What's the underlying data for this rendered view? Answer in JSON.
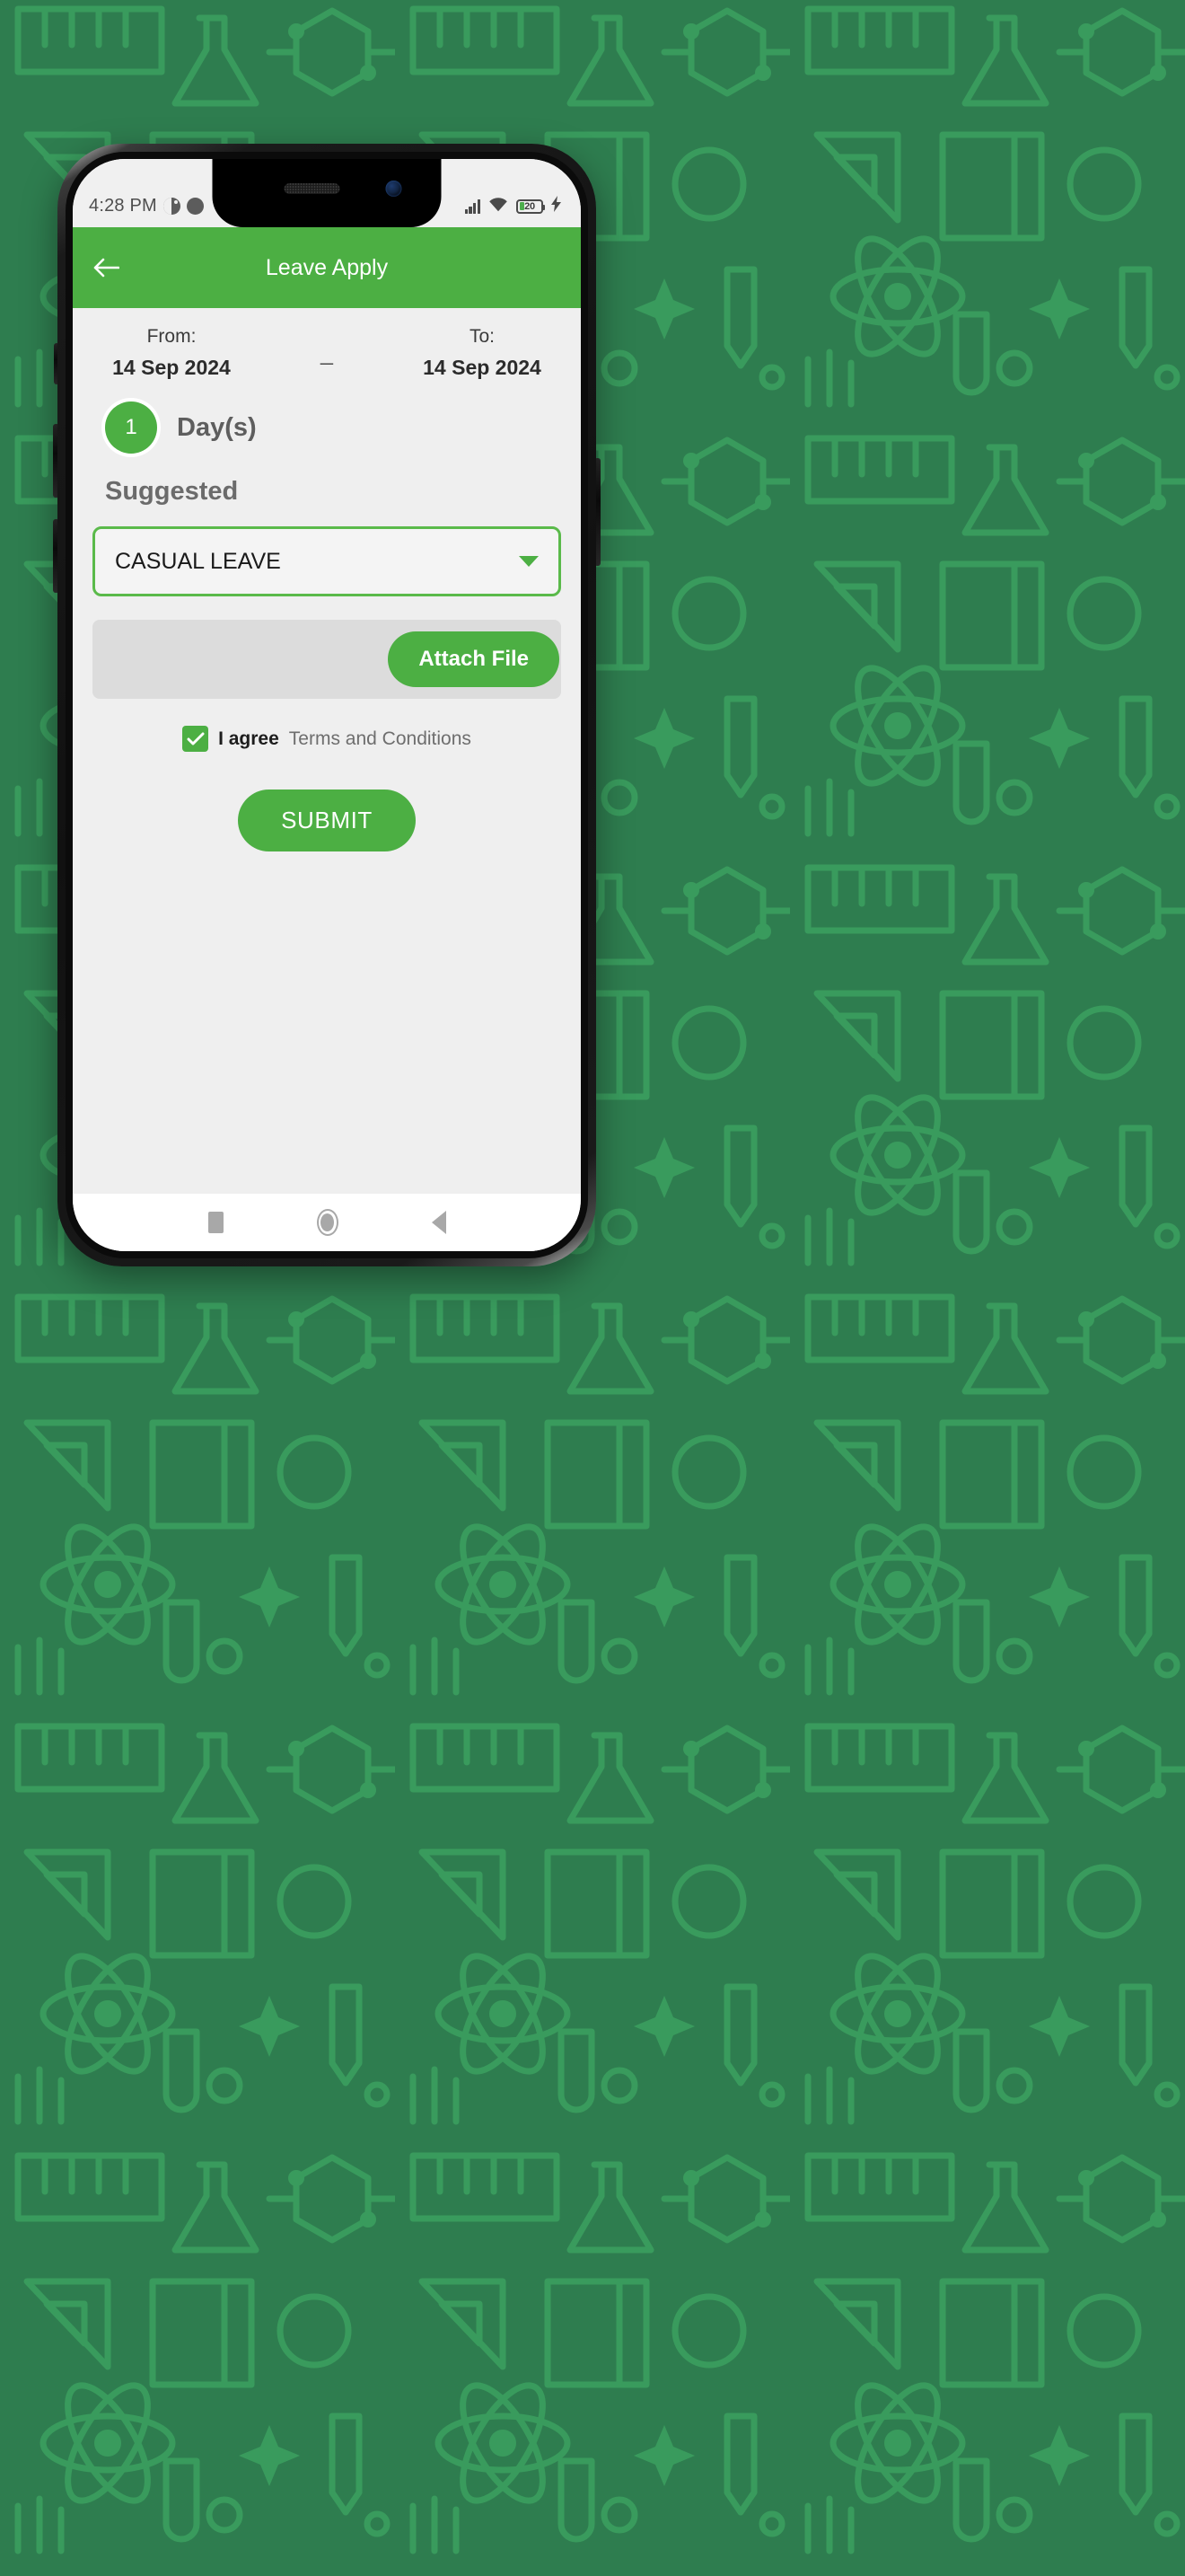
{
  "background": {
    "color": "#2e7d4f",
    "pattern_color": "#3a9e5e",
    "description": "science-doodle-pattern"
  },
  "status_bar": {
    "time": "4:28 PM",
    "icons_left": [
      "circle-half-icon",
      "circle-icon"
    ],
    "icons_right": [
      "signal-icon",
      "wifi-icon",
      "battery-icon",
      "charging-bolt-icon"
    ],
    "battery_level": "20"
  },
  "app_bar": {
    "back_icon": "back-arrow-icon",
    "title": "Leave Apply",
    "color": "#4CAF43"
  },
  "form": {
    "from_label": "From:",
    "from_value": "14 Sep 2024",
    "separator": "_",
    "to_label": "To:",
    "to_value": "14 Sep 2024",
    "days_count": "1",
    "days_label": "Day(s)",
    "suggested_label": "Suggested",
    "leave_type": {
      "selected": "CASUAL LEAVE",
      "caret_icon": "chevron-down-icon"
    },
    "attach": {
      "button_label": "Attach File",
      "file_name": ""
    },
    "agree": {
      "checked": true,
      "check_icon": "check-icon",
      "strong_text": "I agree",
      "terms_text": "Terms and Conditions"
    },
    "submit_label": "SUBMIT"
  },
  "nav_bar": {
    "recents": "square-recents-icon",
    "home": "circle-home-icon",
    "back": "triangle-back-icon"
  }
}
